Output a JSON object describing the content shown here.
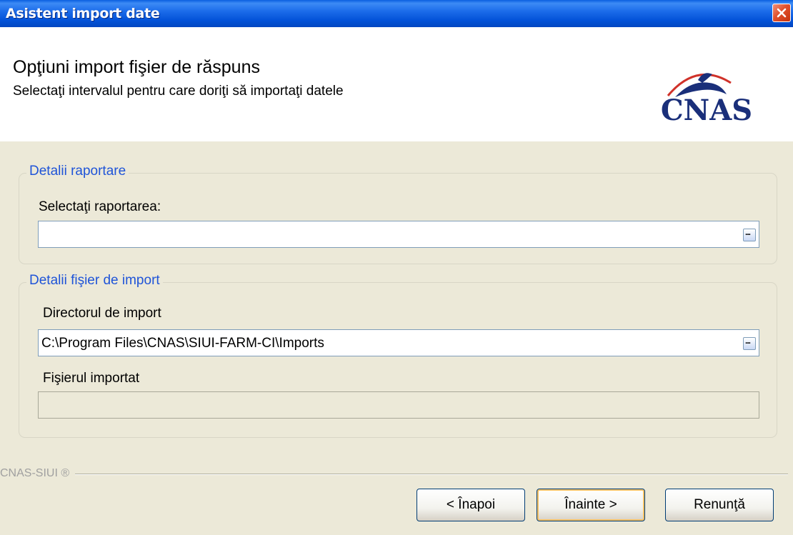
{
  "window": {
    "title": "Asistent import date"
  },
  "header": {
    "title": "Opţiuni import fişier de răspuns",
    "subtitle": "Selectaţi intervalul pentru care doriţi să importaţi datele",
    "logo_text": "CNAS"
  },
  "group_report": {
    "legend": "Detalii raportare",
    "label": "Selectaţi raportarea:",
    "value": "",
    "browse_label": "..."
  },
  "group_file": {
    "legend": "Detalii fişier de import",
    "dir_label": "Directorul de import",
    "dir_value": "C:\\Program Files\\CNAS\\SIUI-FARM-CI\\Imports",
    "browse_label": "...",
    "file_label": "Fişierul importat",
    "file_value": ""
  },
  "footer": {
    "label": "CNAS-SIUI ®"
  },
  "buttons": {
    "back": "< Înapoi",
    "next": "Înainte >",
    "cancel": "Renunţă"
  },
  "colors": {
    "titlebar": "#0352D8",
    "legend": "#1F54D8",
    "logo": "#1A2F7A",
    "logo_arc": "#D0322A",
    "background": "#ECE9D8"
  }
}
